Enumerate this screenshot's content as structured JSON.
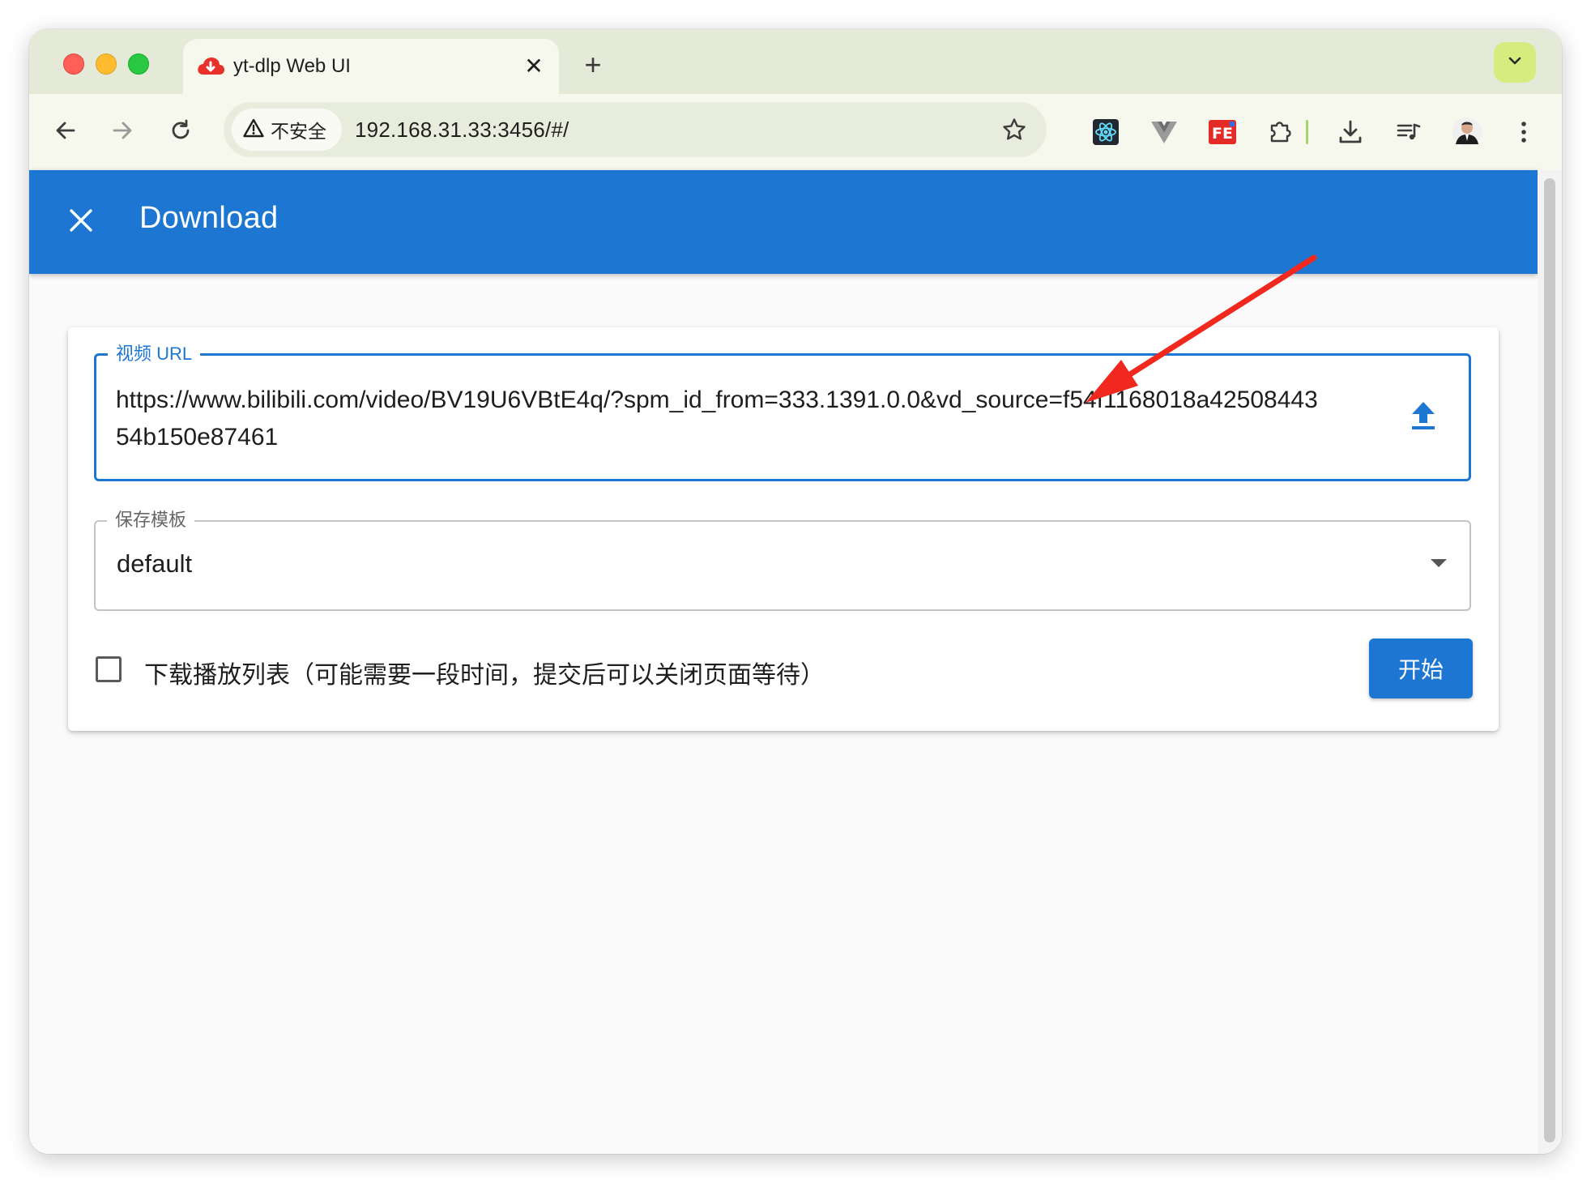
{
  "browser": {
    "tab": {
      "title": "yt-dlp Web UI",
      "favicon": "red-cloud-download-icon",
      "close_glyph": "✕"
    },
    "new_tab_glyph": "+",
    "toolbar": {
      "security_label": "不安全",
      "url": "192.168.31.33:3456/#/"
    },
    "extensions": [
      "react-devtools-icon",
      "vue-devtools-icon",
      "fe-helper-icon",
      "puzzle-icon"
    ]
  },
  "app": {
    "title": "Download",
    "accent_color": "#1c76d2"
  },
  "form": {
    "url_field": {
      "label": "视频 URL",
      "value": "https://www.bilibili.com/video/BV19U6VBtE4q/?spm_id_from=333.1391.0.0&vd_source=f54f1168018a4250844354b150e87461"
    },
    "template_field": {
      "label": "保存模板",
      "value": "default"
    },
    "playlist_checkbox": {
      "label": "下载播放列表（可能需要一段时间，提交后可以关闭页面等待）",
      "checked": false
    },
    "start_button": "开始"
  },
  "annotation_color": "#f0281e"
}
